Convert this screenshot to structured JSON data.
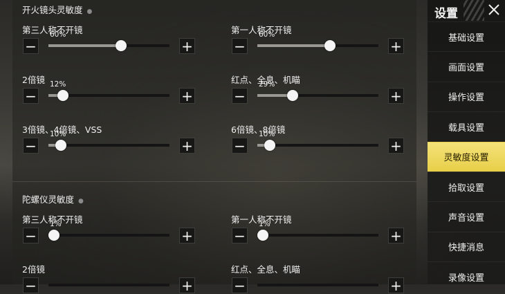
{
  "colors": {
    "accent": "#edd75e",
    "knob": "#f5f5f5",
    "track": "#141414",
    "fill": "#9a9892"
  },
  "sections": [
    {
      "title": "开火镜头灵敏度",
      "sliders": [
        {
          "label": "第三人称不开镜",
          "value_text": "60%",
          "value": 0.6
        },
        {
          "label": "第一人称不开镜",
          "value_text": "60%",
          "value": 0.6
        },
        {
          "label": "2倍镜",
          "value_text": "12%",
          "value": 0.12
        },
        {
          "label": "红点、全息、机瞄",
          "value_text": "29%",
          "value": 0.29
        },
        {
          "label": "3倍镜、4倍镜、VSS",
          "value_text": "10%",
          "value": 0.1
        },
        {
          "label": "6倍镜、8倍镜",
          "value_text": "10%",
          "value": 0.1
        }
      ]
    },
    {
      "title": "陀螺仪灵敏度",
      "sliders": [
        {
          "label": "第三人称不开镜",
          "value_text": "1%",
          "value": 0.01
        },
        {
          "label": "第一人称不开镜",
          "value_text": "1%",
          "value": 0.01
        },
        {
          "label": "2倍镜"
        },
        {
          "label": "红点、全息、机瞄"
        }
      ]
    }
  ],
  "buttons": {
    "minus": "−",
    "plus": "+"
  },
  "sidebar": {
    "title": "设置",
    "close_icon": "close-icon",
    "items": [
      {
        "label": "基础设置",
        "active": false
      },
      {
        "label": "画面设置",
        "active": false
      },
      {
        "label": "操作设置",
        "active": false
      },
      {
        "label": "载具设置",
        "active": false
      },
      {
        "label": "灵敏度设置",
        "active": true
      },
      {
        "label": "拾取设置",
        "active": false
      },
      {
        "label": "声音设置",
        "active": false
      },
      {
        "label": "快捷消息",
        "active": false
      },
      {
        "label": "录像设置",
        "active": false
      }
    ]
  }
}
